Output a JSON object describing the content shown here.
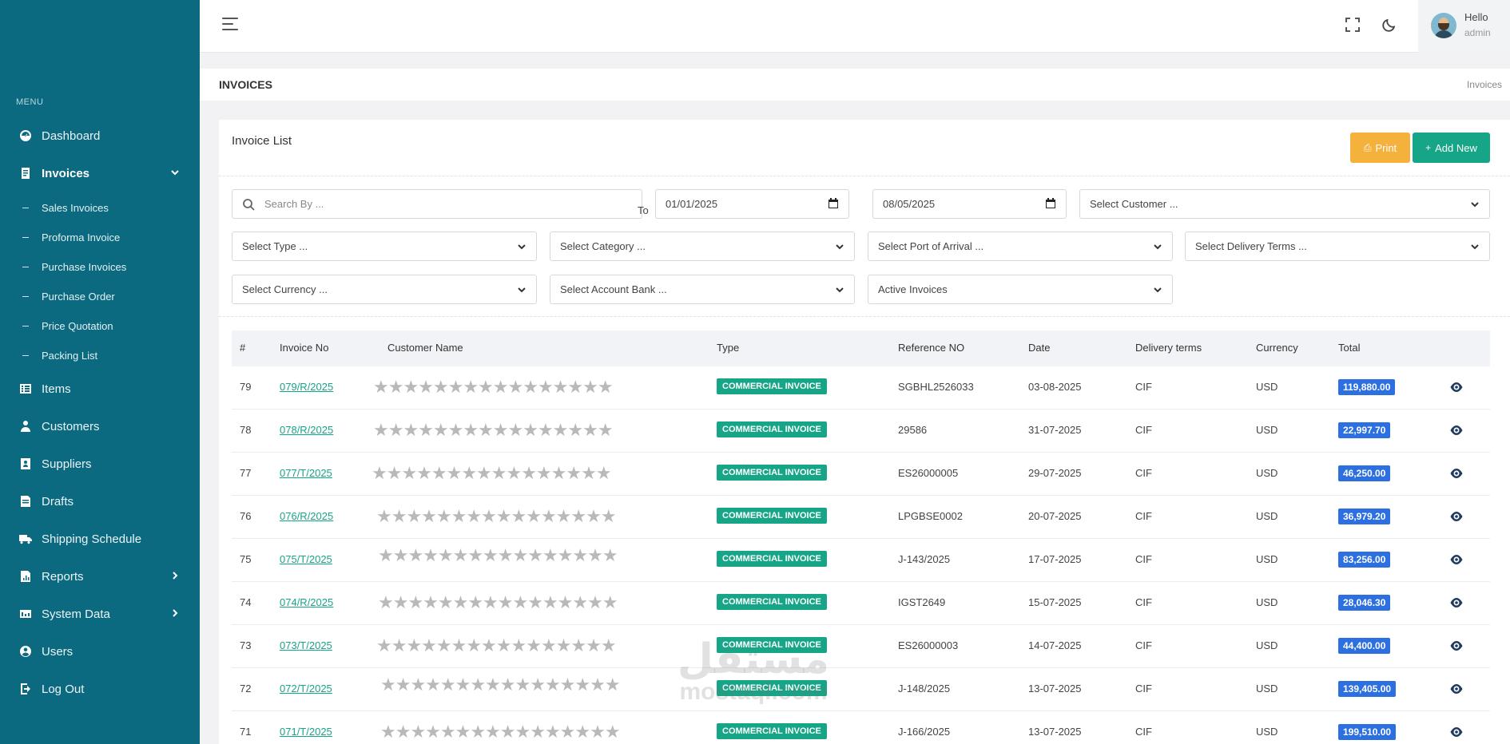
{
  "sidebar": {
    "menu_title": "MENU",
    "items": [
      {
        "label": "Dashboard",
        "icon": "dashboard-icon"
      },
      {
        "label": "Invoices",
        "icon": "invoice-icon"
      },
      {
        "label": "Items",
        "icon": "items-icon"
      },
      {
        "label": "Customers",
        "icon": "customers-icon"
      },
      {
        "label": "Suppliers",
        "icon": "suppliers-icon"
      },
      {
        "label": "Drafts",
        "icon": "drafts-icon"
      },
      {
        "label": "Shipping Schedule",
        "icon": "truck-icon"
      },
      {
        "label": "Reports",
        "icon": "reports-icon"
      },
      {
        "label": "System Data",
        "icon": "system-data-icon"
      },
      {
        "label": "Users",
        "icon": "users-icon"
      },
      {
        "label": "Log Out",
        "icon": "logout-icon"
      }
    ],
    "invoice_sub": [
      "Sales Invoices",
      "Proforma Invoice",
      "Purchase Invoices",
      "Purchase Order",
      "Price Quotation",
      "Packing List"
    ]
  },
  "header": {
    "hello": "Hello",
    "user": "admin"
  },
  "page": {
    "title": "INVOICES",
    "breadcrumb": "Invoices"
  },
  "card": {
    "title": "Invoice List",
    "print_label": "Print",
    "add_label": "Add New"
  },
  "filters": {
    "search_placeholder": "Search By ...",
    "date_from": "01/01/2025",
    "to_label": "To",
    "date_to": "08/05/2025",
    "customer": "Select Customer ...",
    "type": "Select Type ...",
    "category": "Select Category ...",
    "port": "Select Port of Arrival ...",
    "delivery": "Select Delivery Terms ...",
    "currency": "Select Currency ...",
    "bank": "Select Account Bank ...",
    "status": "Active Invoices"
  },
  "table": {
    "headers": [
      "#",
      "Invoice No",
      "Customer Name",
      "Type",
      "Reference NO",
      "Date",
      "Delivery terms",
      "Currency",
      "Total"
    ],
    "rows": [
      {
        "num": "79",
        "invoice": "079/R/2025",
        "customer": "★★★★★★★★★★★★★★★★",
        "type": "COMMERCIAL INVOICE",
        "ref": "SGBHL2526033",
        "date": "03-08-2025",
        "terms": "CIF",
        "currency": "USD",
        "total": "119,880.00"
      },
      {
        "num": "78",
        "invoice": "078/R/2025",
        "customer": "★★★★★★★★★★★★★★★★",
        "type": "COMMERCIAL INVOICE",
        "ref": "29586",
        "date": "31-07-2025",
        "terms": "CIF",
        "currency": "USD",
        "total": "22,997.70"
      },
      {
        "num": "77",
        "invoice": "077/T/2025",
        "customer": "★★★★★★★★★★★★★★★★",
        "type": "COMMERCIAL INVOICE",
        "ref": "ES26000005",
        "date": "29-07-2025",
        "terms": "CIF",
        "currency": "USD",
        "total": "46,250.00"
      },
      {
        "num": "76",
        "invoice": "076/R/2025",
        "customer": "★★★★★★★★★★★★★★★★",
        "type": "COMMERCIAL INVOICE",
        "ref": "LPGBSE0002",
        "date": "20-07-2025",
        "terms": "CIF",
        "currency": "USD",
        "total": "36,979.20"
      },
      {
        "num": "75",
        "invoice": "075/T/2025",
        "customer": "★★★★★★★★★★★★★★★★",
        "type": "COMMERCIAL INVOICE",
        "ref": "J-143/2025",
        "date": "17-07-2025",
        "terms": "CIF",
        "currency": "USD",
        "total": "83,256.00"
      },
      {
        "num": "74",
        "invoice": "074/R/2025",
        "customer": "★★★★★★★★★★★★★★★★",
        "type": "COMMERCIAL INVOICE",
        "ref": "IGST2649",
        "date": "15-07-2025",
        "terms": "CIF",
        "currency": "USD",
        "total": "28,046.30"
      },
      {
        "num": "73",
        "invoice": "073/T/2025",
        "customer": "★★★★★★★★★★★★★★★★",
        "type": "COMMERCIAL INVOICE",
        "ref": "ES26000003",
        "date": "14-07-2025",
        "terms": "CIF",
        "currency": "USD",
        "total": "44,400.00"
      },
      {
        "num": "72",
        "invoice": "072/T/2025",
        "customer": "★★★★★★★★★★★★★★★★",
        "type": "COMMERCIAL INVOICE",
        "ref": "J-148/2025",
        "date": "13-07-2025",
        "terms": "CIF",
        "currency": "USD",
        "total": "139,405.00"
      },
      {
        "num": "71",
        "invoice": "071/T/2025",
        "customer": "★★★★★★★★★★★★★★★★",
        "type": "COMMERCIAL INVOICE",
        "ref": "J-166/2025",
        "date": "13-07-2025",
        "terms": "CIF",
        "currency": "USD",
        "total": "199,510.00"
      }
    ]
  },
  "watermark": {
    "arabic": "مستقل",
    "latin": "mostaql.com"
  },
  "colors": {
    "sidebar": "#0c6a80",
    "accent_green": "#16a587",
    "print_orange": "#f4b13c",
    "total_blue": "#2c6fe0"
  }
}
